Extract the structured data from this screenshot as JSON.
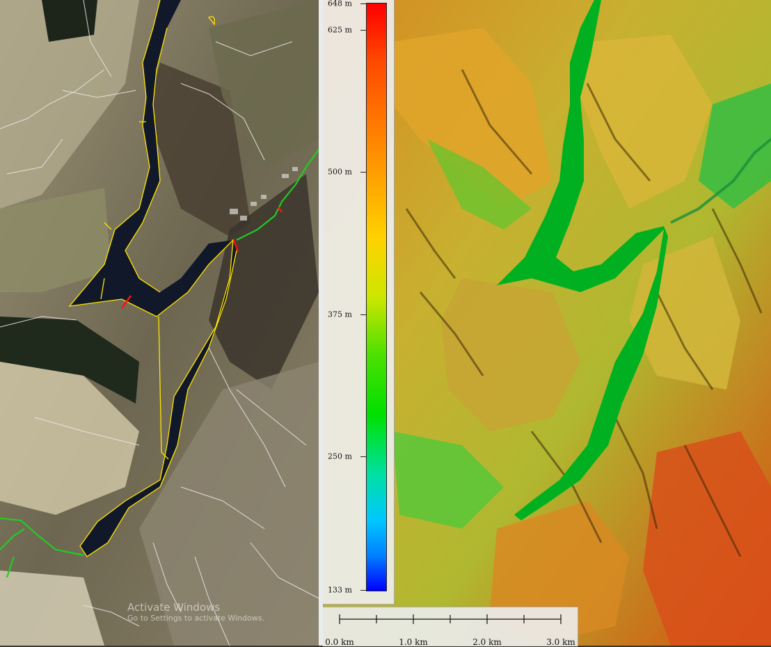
{
  "legend": {
    "ticks": [
      {
        "label": "648 m",
        "value": 648
      },
      {
        "label": "625 m",
        "value": 625
      },
      {
        "label": "500 m",
        "value": 500
      },
      {
        "label": "375 m",
        "value": 375
      },
      {
        "label": "250 m",
        "value": 250
      },
      {
        "label": "133 m",
        "value": 133
      }
    ],
    "min": 133,
    "max": 648,
    "colors": {
      "high": "#ff0000",
      "mid": "#ffd200",
      "low_mid": "#00e000",
      "low": "#0000ff"
    }
  },
  "scale_bar": {
    "labels": [
      "0.0 km",
      "1.0 km",
      "2.0 km",
      "3.0 km"
    ],
    "values_km": [
      0,
      1,
      2,
      3
    ]
  },
  "watermark": {
    "title": "Activate Windows",
    "subtitle": "Go to Settings to activate Windows."
  },
  "colors": {
    "lake_aerial": "#10182a",
    "lake_terrain": "#00b020",
    "shoreline": "#ffe600",
    "streams": "#e8e8e8",
    "paths": "#22cc22",
    "dams": "#ff1010"
  }
}
